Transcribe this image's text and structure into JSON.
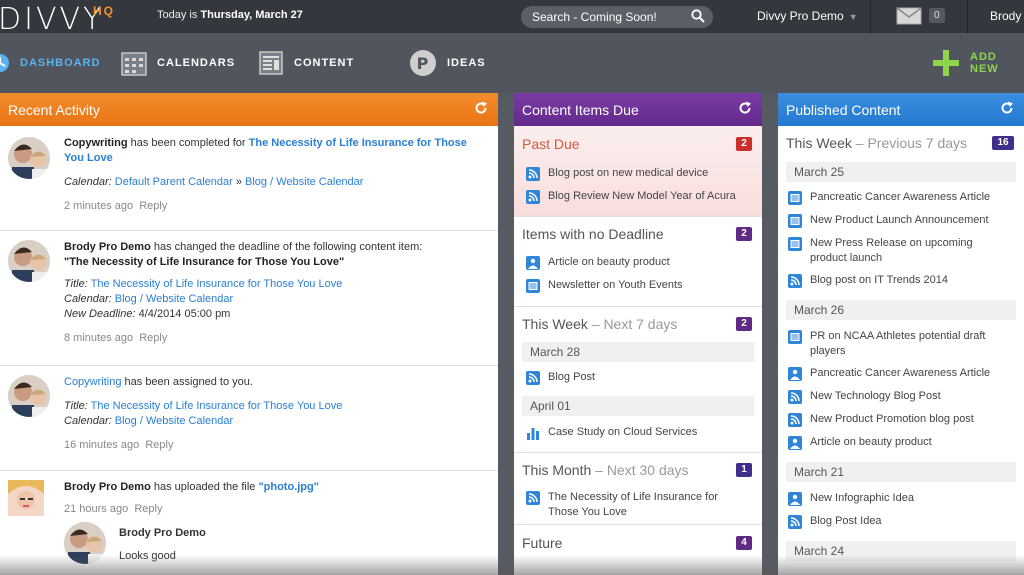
{
  "app": {
    "logo": "DIVVY",
    "logo_sup": "HQ",
    "today_prefix": "Today is ",
    "today_date": "Thursday, March 27",
    "search_placeholder": "Search - Coming Soon!",
    "user_menu": "Divvy Pro Demo",
    "mail_count": "0",
    "user_short": "Brody"
  },
  "nav": {
    "dashboard": "DASHBOARD",
    "calendars": "CALENDARS",
    "content": "CONTENT",
    "ideas": "IDEAS",
    "add_new": "ADD NEW"
  },
  "activity": {
    "title": "Recent Activity",
    "a1": {
      "subject": "Copywriting",
      "text": " has been completed for ",
      "link": "The Necessity of Life Insurance for Those You Love",
      "cal_label": "Calendar:",
      "cal1": "Default Parent Calendar",
      "sep": "»",
      "cal2": "Blog / Website Calendar",
      "time": "2 minutes ago",
      "reply": "Reply"
    },
    "a2": {
      "actor": "Brody Pro Demo",
      "text": " has changed the deadline of the following content item:",
      "item": "\"The Necessity of Life Insurance for Those You Love\"",
      "title_label": "Title:",
      "title": "The Necessity of Life Insurance for Those You Love",
      "cal_label": "Calendar:",
      "cal": "Blog / Website Calendar",
      "deadline_label": "New Deadline:",
      "deadline": "4/4/2014 05:00 pm",
      "time": "8 minutes ago",
      "reply": "Reply"
    },
    "a3": {
      "subject": "Copywriting",
      "text": " has been assigned to you.",
      "title_label": "Title:",
      "title": "The Necessity of Life Insurance for Those You Love",
      "cal_label": "Calendar:",
      "cal": "Blog / Website Calendar",
      "time": "16 minutes ago",
      "reply": "Reply"
    },
    "a4": {
      "actor": "Brody Pro Demo",
      "text": " has uploaded the file ",
      "file": "\"photo.jpg\"",
      "time": "21 hours ago",
      "reply": "Reply",
      "comment_author": "Brody Pro Demo",
      "comment": "Looks good"
    }
  },
  "due": {
    "title": "Content Items Due",
    "past": {
      "title": "Past Due",
      "count": "2",
      "items": [
        "Blog post on new medical device",
        "Blog Review New Model Year of Acura"
      ]
    },
    "nodl": {
      "title": "Items with no Deadline",
      "count": "2",
      "items": [
        "Article on beauty product",
        "Newsletter on Youth Events"
      ]
    },
    "week": {
      "title": "This Week",
      "sub": " – Next 7 days",
      "count": "2",
      "d1": "March 28",
      "i1": "Blog Post",
      "d2": "April 01",
      "i2": "Case Study on Cloud Services"
    },
    "month": {
      "title": "This Month",
      "sub": " – Next 30 days",
      "count": "1",
      "i1": "The Necessity of Life Insurance for Those You Love"
    },
    "future": {
      "title": "Future",
      "count": "4"
    }
  },
  "published": {
    "title": "Published Content",
    "week": "This Week",
    "sub": " – Previous 7 days",
    "count": "16",
    "d1": "March 25",
    "d1_items": [
      "Pancreatic Cancer Awareness Article",
      "New Product Launch Announcement",
      "New Press Release on upcoming product launch",
      "Blog post on IT Trends 2014"
    ],
    "d2": "March 26",
    "d2_items": [
      "PR on NCAA Athletes potential draft players",
      "Pancreatic Cancer Awareness Article",
      "New Technology Blog Post",
      "New Product Promotion blog post",
      "Article on beauty product"
    ],
    "d3": "March 21",
    "d3_items": [
      "New Infographic Idea",
      "Blog Post Idea"
    ],
    "d4": "March 24"
  },
  "colors": {
    "accent_orange": "#f28d2b",
    "accent_purple": "#6c2f96",
    "accent_blue": "#2f85d8",
    "badge_red": "#c9302c",
    "badge_purple": "#5e2a84",
    "badge_navy": "#3f2f8a"
  }
}
